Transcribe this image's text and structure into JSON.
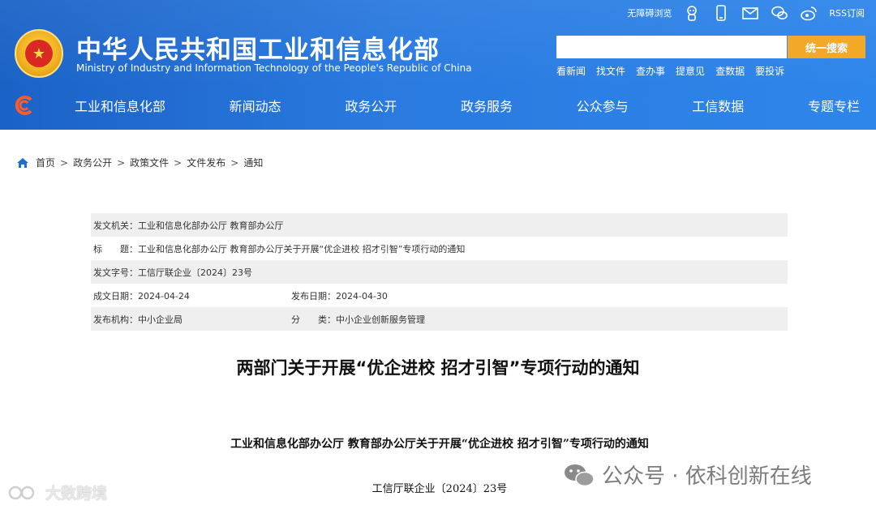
{
  "header": {
    "title_cn": "中华人民共和国工业和信息化部",
    "title_en": "Ministry of Industry and Information Technology of the People's Republic of China",
    "top_links": {
      "accessibility": "无障碍浏览",
      "rss": "RSS订阅"
    },
    "search": {
      "placeholder": "",
      "button": "统一搜索"
    },
    "quick_links": [
      "看新闻",
      "找文件",
      "查办事",
      "提意见",
      "查数据",
      "要投诉"
    ],
    "nav": [
      "工业和信息化部",
      "新闻动态",
      "政务公开",
      "政务服务",
      "公众参与",
      "工信数据",
      "专题专栏"
    ]
  },
  "breadcrumb": [
    "首页",
    "政务公开",
    "政策文件",
    "文件发布",
    "通知"
  ],
  "breadcrumb_sep": ">",
  "meta": {
    "issuer": "发文机关：工业和信息化部办公厅 教育部办公厅",
    "title": "标　　题：工业和信息化部办公厅 教育部办公厅关于开展“优企进校 招才引智”专项行动的通知",
    "doc_no": "发文字号：工信厅联企业〔2024〕23号",
    "date_created": "成文日期：2024-04-24",
    "date_published": "发布日期：2024-04-30",
    "agency": "发布机构：中小企业局",
    "category": "分　　类：中小企业创新服务管理"
  },
  "document": {
    "title": "两部门关于开展“优企进校 招才引智”专项行动的通知",
    "subtitle": "工业和信息化部办公厅  教育部办公厅关于开展“优企进校  招才引智”专项行动的通知",
    "number": "工信厅联企业〔2024〕23号"
  },
  "watermarks": {
    "left": "大数跨境",
    "right": "公众号 · 依科创新在线"
  },
  "colors": {
    "header_blue": "#2a7ae0",
    "search_button": "#f4a623",
    "meta_row_shade": "#efefef"
  }
}
